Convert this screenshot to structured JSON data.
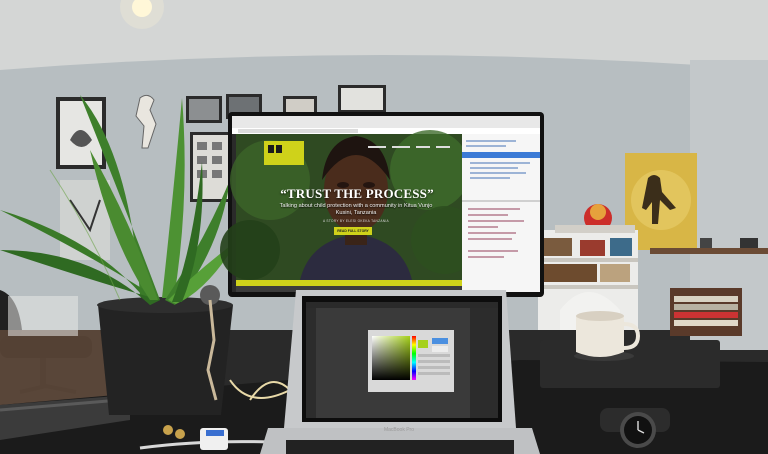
{
  "monitor": {
    "headline": "“TRUST THE PROCESS”",
    "subhead": "Talking about child protection with a community in Kitua Vunjo Kusini, Tanzania",
    "byline": "A STORY BY ELESI OKEKA TANZANIA",
    "button_label": "READ FULL STORY"
  },
  "laptop": {
    "brand_label": "MacBook Pro"
  },
  "colors": {
    "wall": "#b9bfc2",
    "ceiling": "#d7d9d8",
    "desk": "#1c1c1c",
    "accent_yellow": "#cfd21a",
    "poster_yellow": "#d9b84a",
    "plant_green": "#3f7d2c"
  }
}
